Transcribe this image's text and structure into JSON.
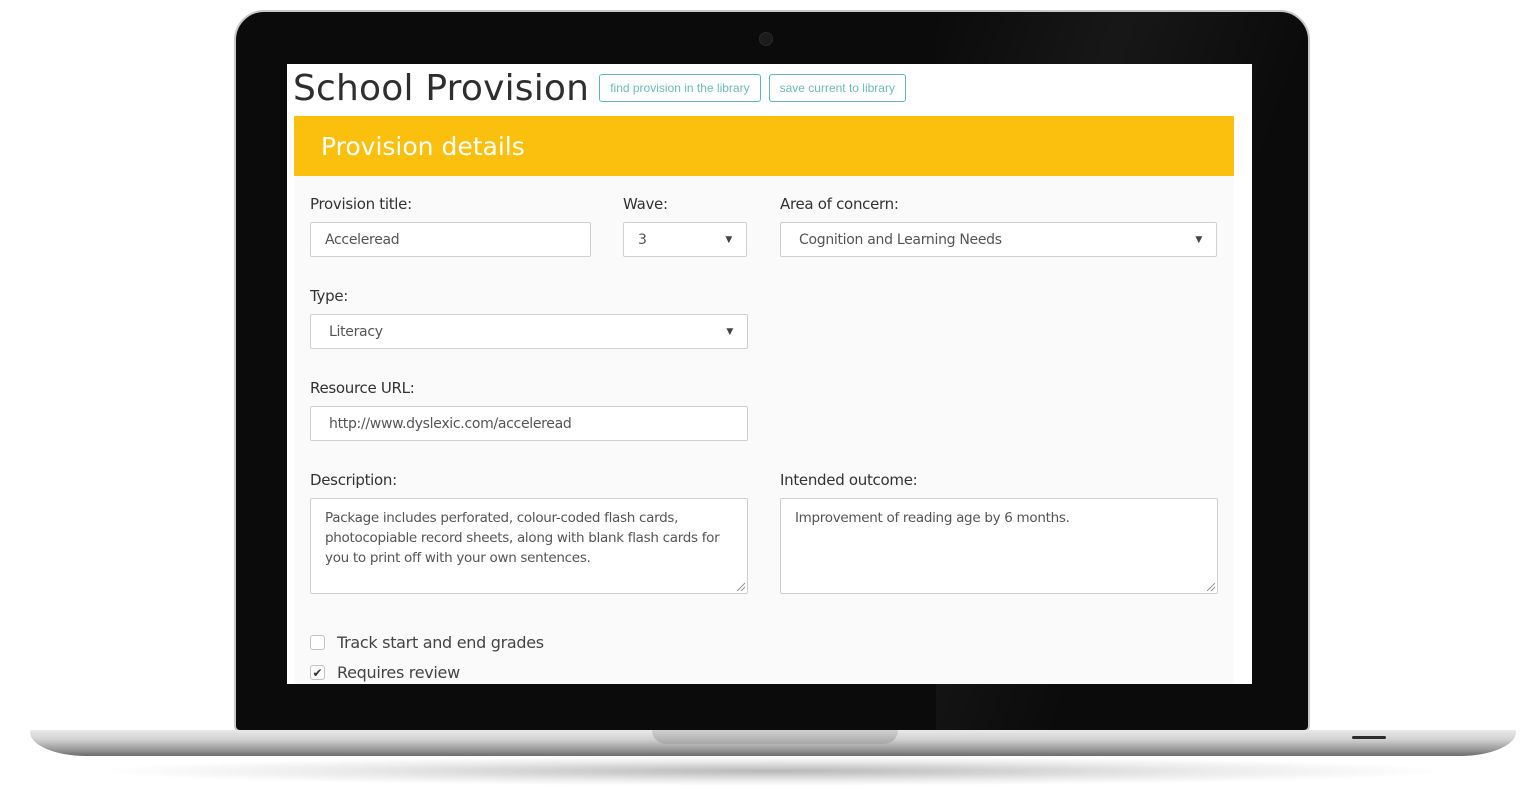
{
  "header": {
    "title": "School Provision",
    "find_button": "find provision in the library",
    "save_button": "save current to library"
  },
  "panel": {
    "title": "Provision details",
    "accent_color": "#fbc00e"
  },
  "form": {
    "provision_title": {
      "label": "Provision title:",
      "value": "Acceleread"
    },
    "wave": {
      "label": "Wave:",
      "value": "3"
    },
    "area_of_concern": {
      "label": "Area of concern:",
      "value": "Cognition and Learning Needs"
    },
    "type": {
      "label": "Type:",
      "value": "Literacy"
    },
    "resource_url": {
      "label": "Resource URL:",
      "value": "http://www.dyslexic.com/acceleread"
    },
    "description": {
      "label": "Description:",
      "value": "Package includes perforated, colour-coded flash cards, photocopiable record sheets, along with blank flash cards for you to print off with your own sentences."
    },
    "intended_outcome": {
      "label": "Intended outcome:",
      "value": "Improvement of reading age by 6 months."
    },
    "track_grades": {
      "label": "Track start and end grades",
      "checked": false
    },
    "requires_review": {
      "label": "Requires review",
      "checked": true
    }
  },
  "icons": {
    "dropdown": "chevron-down-icon",
    "check": "checkmark-icon"
  }
}
